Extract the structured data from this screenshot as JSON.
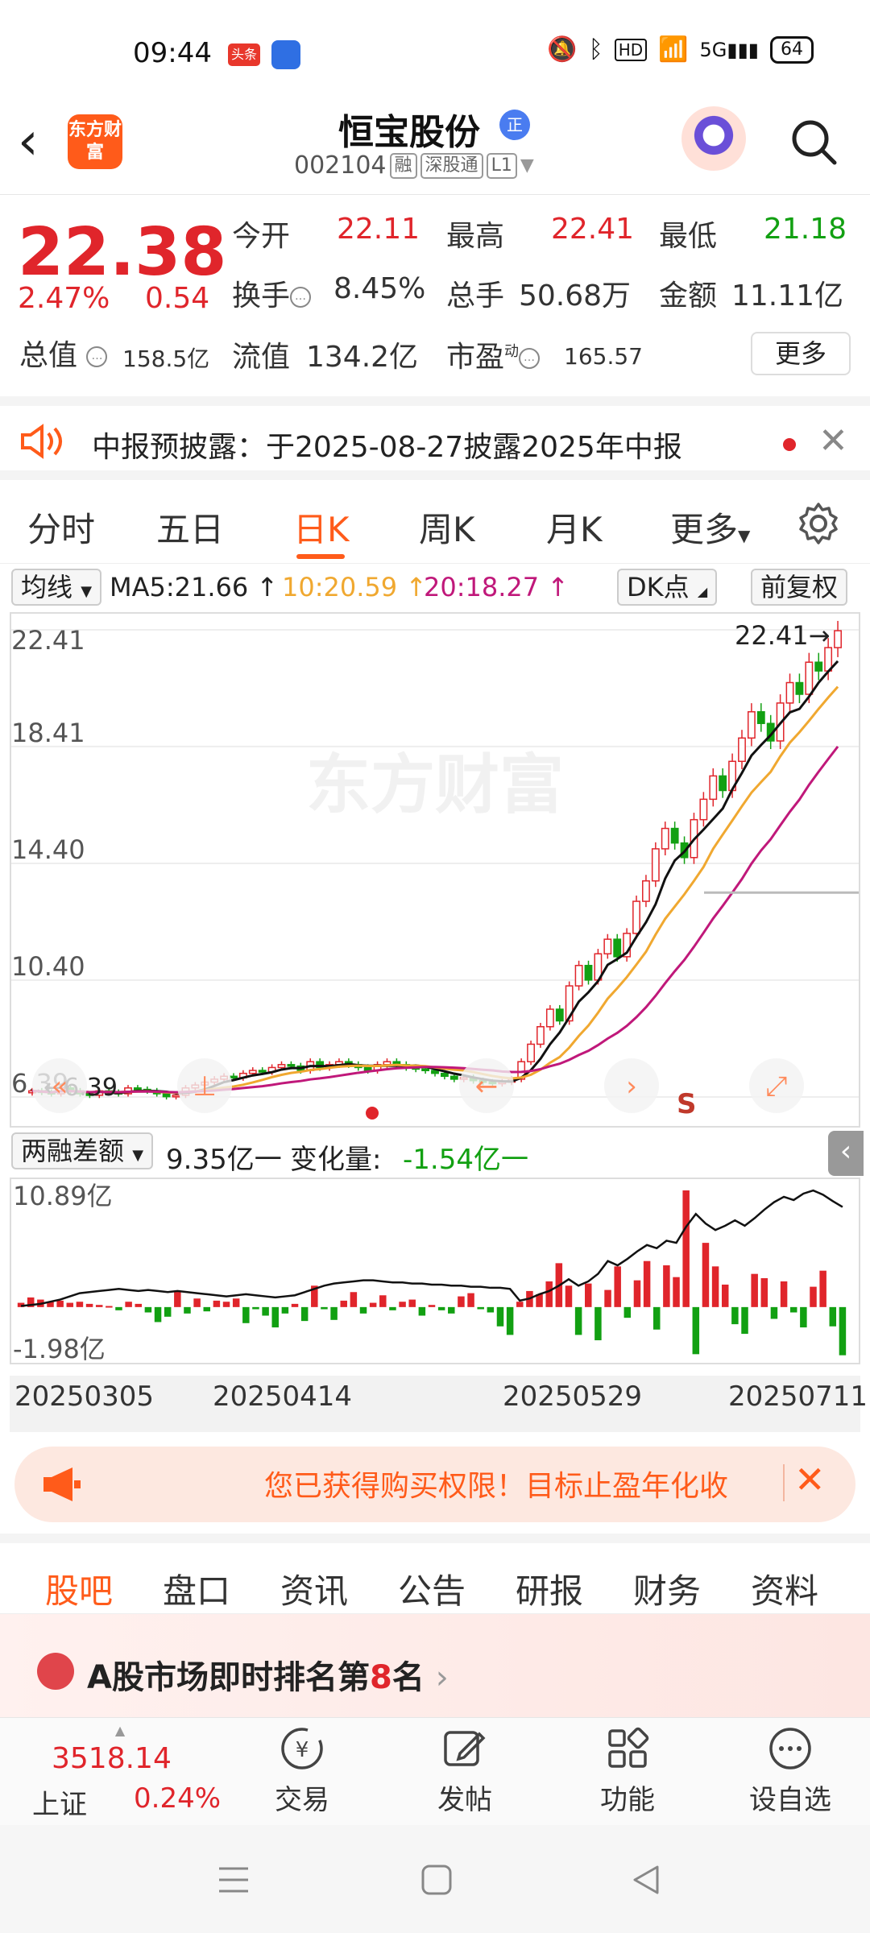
{
  "status_bar": {
    "time": "09:44",
    "app_badge": "头条",
    "battery": "64"
  },
  "header": {
    "stock_name": "恒宝股份",
    "badge": "正",
    "code": "002104",
    "tags": [
      "融",
      "深股通",
      "L1"
    ],
    "back_icon": "chevron-left-icon",
    "logo_text": "东方财富"
  },
  "quote": {
    "price": "22.38",
    "change_pct": "2.47%",
    "change": "0.54",
    "labels": {
      "open": "今开",
      "high": "最高",
      "low": "最低",
      "turnover": "换手",
      "volume": "总手",
      "amount": "金额",
      "total_value": "总值",
      "float_value": "流值",
      "pe": "市盈",
      "pe_sup": "动"
    },
    "values": {
      "open": "22.11",
      "high": "22.41",
      "low": "21.18",
      "turnover": "8.45%",
      "volume": "50.68万",
      "amount": "11.11亿",
      "total_value": "158.5亿",
      "float_value": "134.2亿",
      "pe": "165.57"
    },
    "more": "更多"
  },
  "notice": {
    "text": "中报预披露：于2025-08-27披露2025年中报"
  },
  "kline_tabs": [
    "分时",
    "五日",
    "日K",
    "周K",
    "月K",
    "更多"
  ],
  "kline_active": 2,
  "chart_header": {
    "ma_select": "均线",
    "ma5": "MA5:21.66",
    "ma10": "10:20.59",
    "ma20": "20:18.27",
    "dk": "DK点",
    "adjust": "前复权"
  },
  "chart_data": {
    "type": "candlestick",
    "y_ticks": [
      "22.41",
      "18.41",
      "14.40",
      "10.40",
      "6.39"
    ],
    "ylim": [
      6.39,
      22.41
    ],
    "last_high_label": "22.41",
    "low_label": "6.39",
    "watermark": "东方财富",
    "marker": "S",
    "x_dates": [
      "20250305",
      "20250414",
      "20250529",
      "20250711"
    ],
    "close": [
      6.6,
      6.55,
      6.5,
      6.7,
      6.6,
      6.5,
      6.45,
      6.6,
      6.55,
      6.5,
      6.7,
      6.65,
      6.6,
      6.5,
      6.4,
      6.45,
      6.7,
      6.8,
      6.9,
      7.0,
      7.1,
      7.05,
      7.2,
      7.3,
      7.25,
      7.4,
      7.5,
      7.45,
      7.3,
      7.6,
      7.4,
      7.5,
      7.6,
      7.5,
      7.4,
      7.3,
      7.5,
      7.6,
      7.5,
      7.4,
      7.35,
      7.3,
      7.2,
      7.1,
      7.0,
      7.05,
      6.95,
      6.9,
      6.85,
      6.9,
      7.0,
      7.6,
      8.2,
      8.8,
      9.4,
      9.0,
      10.2,
      10.9,
      10.4,
      11.3,
      11.8,
      11.2,
      12.0,
      13.1,
      13.8,
      14.9,
      15.6,
      15.1,
      14.6,
      15.9,
      16.6,
      17.4,
      16.9,
      17.9,
      18.7,
      19.6,
      19.2,
      18.6,
      19.9,
      20.6,
      20.2,
      21.3,
      21.0,
      21.8,
      22.38
    ],
    "series": [
      {
        "name": "MA5",
        "value_label": "21.66"
      },
      {
        "name": "10",
        "value_label": "20.59"
      },
      {
        "name": "20",
        "value_label": "18.27"
      }
    ]
  },
  "margin": {
    "select": "两融差额",
    "value": "9.35亿",
    "change_label": "变化量:",
    "change_value": "-1.54亿",
    "ytop": "10.89亿",
    "ybottom": "-1.98亿",
    "bars": [
      0.4,
      0.9,
      0.7,
      0.5,
      0.6,
      0.4,
      0.5,
      0.3,
      0.2,
      0.1,
      -0.3,
      0.5,
      0.3,
      -0.5,
      -1.4,
      -0.9,
      1.5,
      -0.6,
      0.8,
      -0.4,
      0.6,
      0.5,
      0.8,
      -1.5,
      -0.2,
      -0.8,
      -1.9,
      -0.6,
      0.3,
      -1.3,
      2.0,
      -0.2,
      -1.2,
      0.6,
      1.4,
      -0.6,
      0.4,
      1.1,
      -0.3,
      0.5,
      0.7,
      -0.8,
      0.2,
      -0.3,
      -0.6,
      1.0,
      1.3,
      -0.2,
      -0.5,
      -1.8,
      -2.6,
      0.5,
      1.5,
      1.2,
      2.4,
      4.1,
      2.0,
      -2.6,
      2.2,
      -3.1,
      1.6,
      3.8,
      -1.0,
      2.5,
      4.3,
      -2.1,
      3.9,
      2.8,
      10.9,
      -4.4,
      6.0,
      3.8,
      2.1,
      -1.6,
      -2.5,
      3.1,
      2.7,
      -1.1,
      2.4,
      -0.5,
      -1.9,
      1.9,
      3.4,
      -1.8,
      -4.5
    ],
    "line": [
      0.1,
      0.2,
      0.3,
      0.5,
      0.7,
      1.0,
      1.3,
      1.4,
      1.5,
      1.6,
      1.7,
      1.6,
      1.5,
      1.6,
      1.5,
      1.4,
      1.5,
      1.4,
      1.3,
      1.2,
      1.1,
      1.0,
      1.1,
      1.2,
      1.1,
      1.0,
      0.9,
      1.0,
      1.1,
      1.4,
      1.7,
      2.0,
      2.2,
      2.3,
      2.4,
      2.5,
      2.5,
      2.4,
      2.3,
      2.3,
      2.2,
      2.2,
      2.1,
      2.1,
      2.0,
      2.0,
      1.9,
      1.9,
      1.8,
      1.8,
      1.7,
      0.6,
      0.8,
      1.2,
      1.5,
      2.0,
      2.6,
      2.0,
      2.4,
      3.1,
      4.3,
      3.9,
      4.5,
      5.2,
      5.8,
      5.5,
      6.2,
      6.0,
      7.5,
      8.7,
      7.8,
      7.2,
      7.6,
      8.1,
      7.6,
      8.3,
      9.1,
      9.8,
      10.3,
      10.0,
      10.6,
      10.89,
      10.5,
      9.9,
      9.35
    ]
  },
  "dates": [
    "20250305",
    "20250414",
    "20250529",
    "20250711"
  ],
  "promo": {
    "text": "您已获得购买权限！目标止盈年化收",
    "icon": "megaphone-icon"
  },
  "bottom_tabs": [
    "股吧",
    "盘口",
    "资讯",
    "公告",
    "研报",
    "财务",
    "资料"
  ],
  "bottom_active": 0,
  "rank": {
    "prefix": "A股市场即时排名第",
    "num": "8",
    "suffix": "名"
  },
  "bottom_bar": {
    "index_value": "3518.14",
    "index_name": "上证",
    "index_change": "0.24%",
    "items": [
      "交易",
      "发帖",
      "功能",
      "设自选"
    ]
  },
  "colors": {
    "up": "#e0252b",
    "down": "#12a012",
    "accent": "#ff5b1a",
    "ma5": "#111111",
    "ma10": "#f0a830",
    "ma20": "#c0187a"
  }
}
